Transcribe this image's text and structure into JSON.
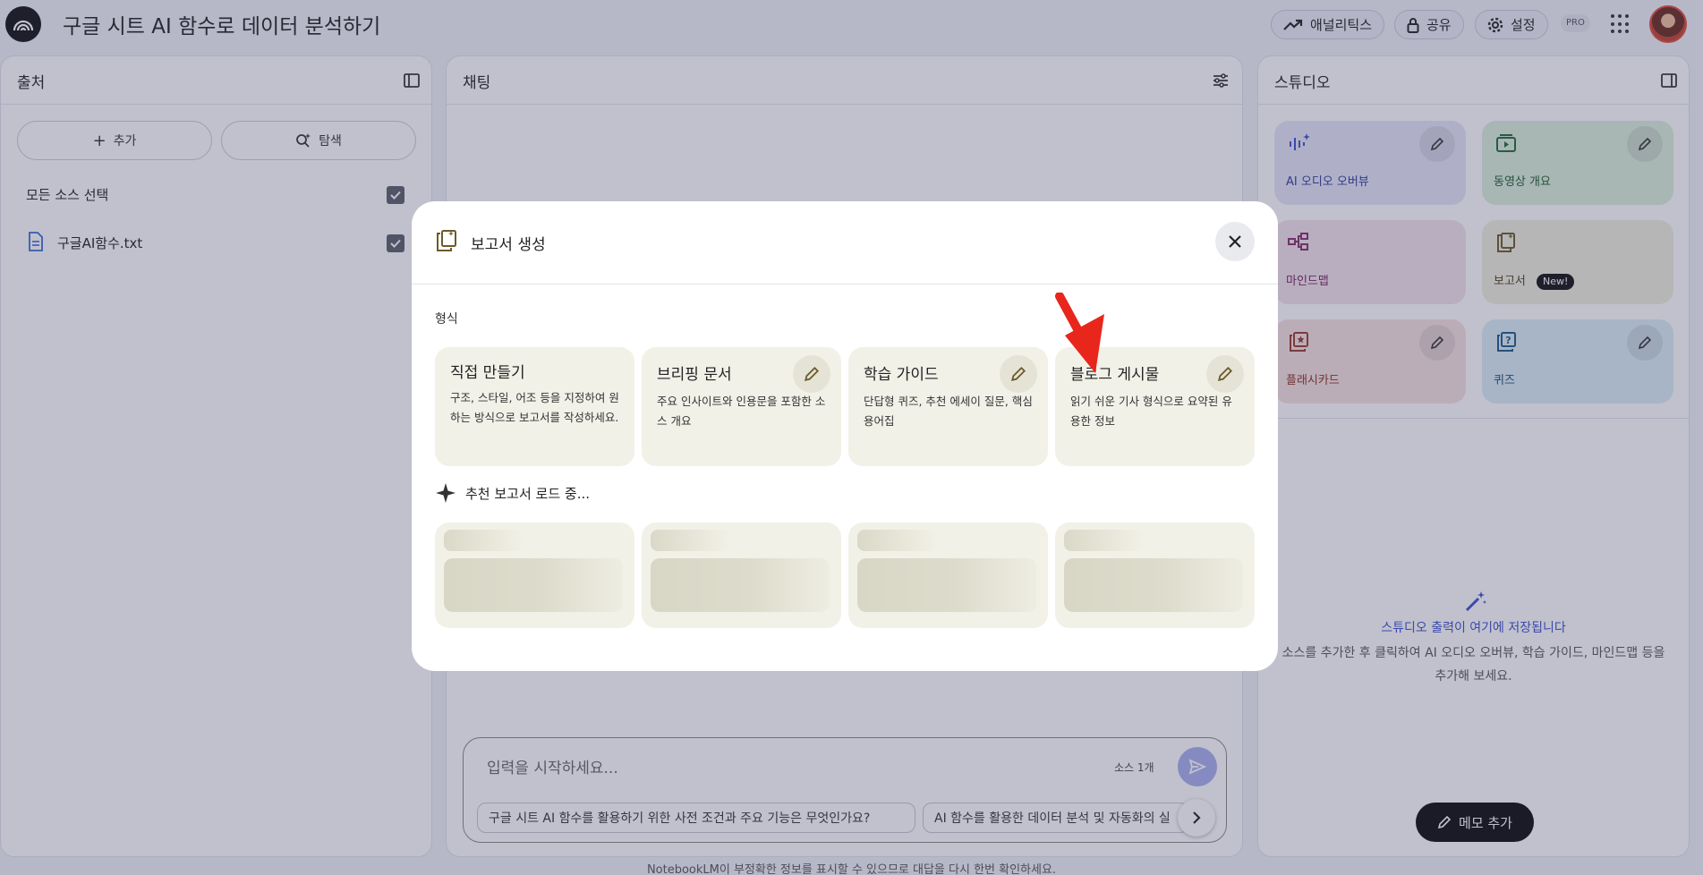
{
  "header": {
    "title": "구글 시트 AI 함수로 데이터 분석하기",
    "analytics_label": "애널리틱스",
    "share_label": "공유",
    "settings_label": "설정",
    "pro_badge": "PRO"
  },
  "sources": {
    "title": "출처",
    "add_label": "추가",
    "explore_label": "탐색",
    "select_all_label": "모든 소스 선택",
    "items": [
      {
        "name": "구글AI함수.txt"
      }
    ]
  },
  "chat": {
    "title": "채팅",
    "input_placeholder": "입력을 시작하세요...",
    "source_count": "소스 1개",
    "suggestions": [
      "구글 시트 AI 함수를 활용하기 위한 사전 조건과 주요 기능은 무엇인가요?",
      "AI 함수를 활용한 데이터 분석 및 자동화의 실"
    ]
  },
  "studio": {
    "title": "스튜디오",
    "cards": [
      {
        "label": "AI 오디오 오버뷰",
        "color": "#e6e6fa"
      },
      {
        "label": "동영상 개요",
        "color": "#dcefdc"
      },
      {
        "label": "마인드맵",
        "color": "#f3e3ec"
      },
      {
        "label": "보고서",
        "color": "#f2efdf",
        "badge": "New!"
      },
      {
        "label": "플래시카드",
        "color": "#f8e2e0"
      },
      {
        "label": "퀴즈",
        "color": "#dcedf6"
      }
    ],
    "empty_title": "스튜디오 출력이 여기에 저장됩니다",
    "empty_desc": "소스를 추가한 후 클릭하여 AI 오디오 오버뷰, 학습 가이드, 마인드맵 등을 추가해 보세요.",
    "memo_label": "메모 추가"
  },
  "modal": {
    "title": "보고서 생성",
    "section_label": "형식",
    "formats": [
      {
        "title": "직접 만들기",
        "desc": "구조, 스타일, 어조 등을 지정하여 원하는 방식으로 보고서를 작성하세요."
      },
      {
        "title": "브리핑 문서",
        "desc": "주요 인사이트와 인용문을 포함한 소스 개요"
      },
      {
        "title": "학습 가이드",
        "desc": "단답형 퀴즈, 추천 에세이 질문, 핵심 용어집"
      },
      {
        "title": "블로그 게시물",
        "desc": "읽기 쉬운 기사 형식으로 요약된 유용한 정보"
      }
    ],
    "loading_label": "추천 보고서 로드 중..."
  },
  "footer": {
    "note": "NotebookLM이 부정확한 정보를 표시할 수 있으므로 대답을 다시 한번 확인하세요."
  },
  "colors": {
    "accent": "#3b4fd1",
    "arrow": "#e8261c"
  }
}
